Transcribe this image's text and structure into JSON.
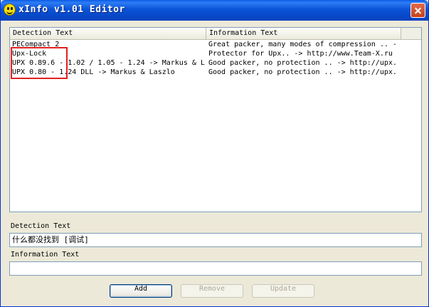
{
  "window": {
    "title": "xInfo v1.01 Editor"
  },
  "list": {
    "columns": [
      "Detection Text",
      "Information Text"
    ],
    "rows": [
      {
        "detection": "PECompact 2",
        "info": "Great packer, many modes of compression .. - "
      },
      {
        "detection": "Upx-Lock",
        "info": "Protector for Upx..  -> http://www.Team-X.ru"
      },
      {
        "detection": "UPX 0.89.6 - 1.02 / 1.05 - 1.24 -> Markus & L",
        "info": "Good packer, no protection ..  -> http://upx."
      },
      {
        "detection": "UPX 0.80 - 1.24 DLL -> Markus & Laszlo",
        "info": "Good packer, no protection ..  -> http://upx."
      }
    ]
  },
  "form": {
    "detection_label": "Detection Text",
    "detection_value": "什么都没找到  [调试]",
    "info_label": "Information Text",
    "info_value": ""
  },
  "buttons": {
    "add": "Add",
    "remove": "Remove",
    "update": "Update"
  },
  "colors": {
    "titlebar": "#0b54d8",
    "highlight_box": "#e32020",
    "face": "#ece9d8"
  }
}
